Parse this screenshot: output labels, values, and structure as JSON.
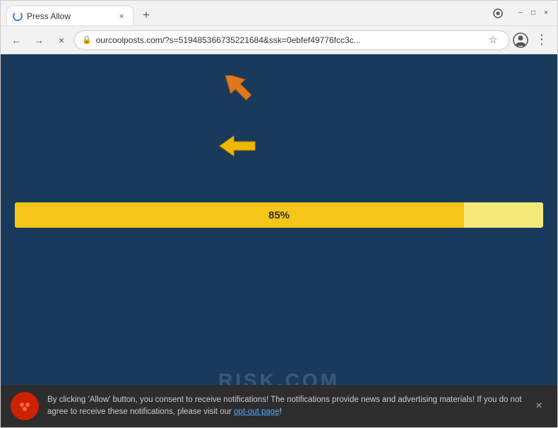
{
  "browser": {
    "tab": {
      "title": "Press Allow",
      "loading": true,
      "close_label": "×"
    },
    "new_tab_label": "+",
    "window_controls": {
      "minimize": "−",
      "maximize": "□",
      "close": "×"
    },
    "nav": {
      "back_label": "←",
      "forward_label": "→",
      "reload_label": "×",
      "url": "ourcoolposts.com/?s=519485366735221684&ssk=0ebfef49776fcc3c...",
      "lock_icon": "🔒",
      "star_icon": "☆",
      "profile_icon": "👤",
      "menu_icon": "⋮"
    }
  },
  "page": {
    "background_color": "#1a3a5c",
    "progress": {
      "value": 85,
      "label": "85%",
      "fill_color": "#f5c518",
      "track_color": "#f5e87a"
    },
    "notification": {
      "text_part1": "By clicking 'Allow' button, you consent to receive notifications! The notifications provide news and advertising materials! If you do not agree to receive these notifications, please visit our ",
      "link_text": "opt-out page",
      "text_part2": "!",
      "close_label": "×"
    },
    "watermark": "RISK.COM"
  },
  "arrows": {
    "orange_color": "#e07820",
    "yellow_color": "#f0b800"
  }
}
